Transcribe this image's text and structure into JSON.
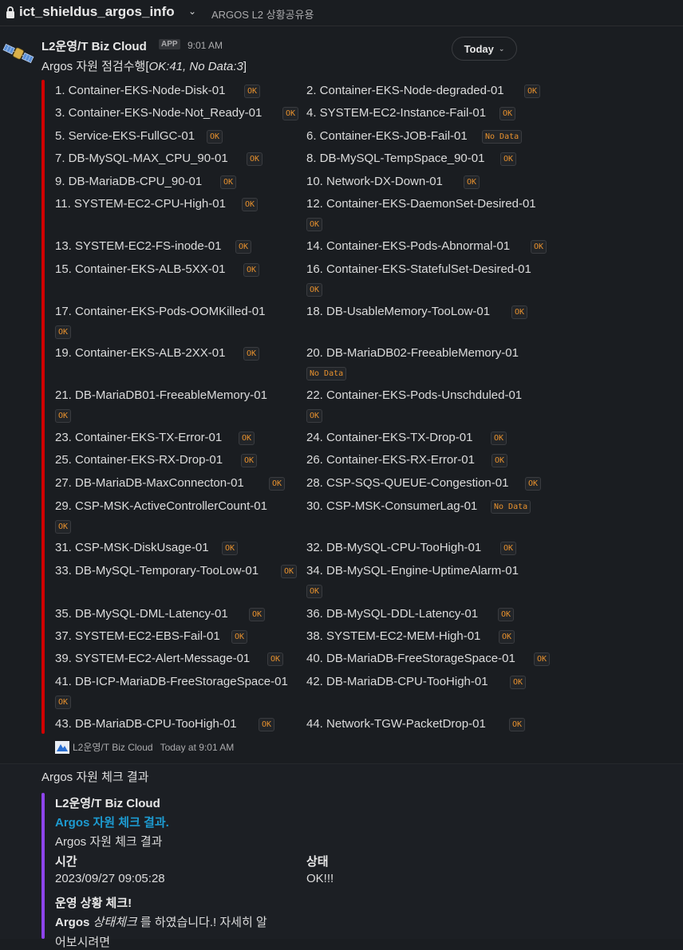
{
  "channel": {
    "name": "ict_shieldus_argos_info",
    "description": "ARGOS L2 상황공유용"
  },
  "message1": {
    "sender": "L2운영/T Biz Cloud",
    "app_badge": "APP",
    "time": "9:01 AM",
    "date_pill": "Today",
    "text_prefix": "Argos 자원 점검수행[",
    "text_italic": "OK:41, No Data:3",
    "text_suffix": "]",
    "items": [
      {
        "label": "1. Container-EKS-Node-Disk-01",
        "status": "OK"
      },
      {
        "label": "2. Container-EKS-Node-degraded-01",
        "status": "OK"
      },
      {
        "label": "3. Container-EKS-Node-Not_Ready-01",
        "status": "OK"
      },
      {
        "label": "4. SYSTEM-EC2-Instance-Fail-01",
        "status": "OK"
      },
      {
        "label": "5. Service-EKS-FullGC-01",
        "status": "OK"
      },
      {
        "label": "6. Container-EKS-JOB-Fail-01",
        "status": "No Data"
      },
      {
        "label": "7. DB-MySQL-MAX_CPU_90-01",
        "status": "OK"
      },
      {
        "label": "8. DB-MySQL-TempSpace_90-01",
        "status": "OK"
      },
      {
        "label": "9. DB-MariaDB-CPU_90-01",
        "status": "OK"
      },
      {
        "label": "10. Network-DX-Down-01",
        "status": "OK"
      },
      {
        "label": "11. SYSTEM-EC2-CPU-High-01",
        "status": "OK"
      },
      {
        "label": "12. Container-EKS-DaemonSet-Desired-01",
        "status": "OK"
      },
      {
        "label": "13. SYSTEM-EC2-FS-inode-01",
        "status": "OK"
      },
      {
        "label": "14. Container-EKS-Pods-Abnormal-01",
        "status": "OK"
      },
      {
        "label": "15. Container-EKS-ALB-5XX-01",
        "status": "OK"
      },
      {
        "label": "16. Container-EKS-StatefulSet-Desired-01",
        "status": "OK"
      },
      {
        "label": "17. Container-EKS-Pods-OOMKilled-01",
        "status": "OK"
      },
      {
        "label": "18. DB-UsableMemory-TooLow-01",
        "status": "OK"
      },
      {
        "label": "19. Container-EKS-ALB-2XX-01",
        "status": "OK"
      },
      {
        "label": "20. DB-MariaDB02-FreeableMemory-01",
        "status": "No Data"
      },
      {
        "label": "21. DB-MariaDB01-FreeableMemory-01",
        "status": "OK"
      },
      {
        "label": "22. Container-EKS-Pods-Unschduled-01",
        "status": "OK"
      },
      {
        "label": "23. Container-EKS-TX-Error-01",
        "status": "OK"
      },
      {
        "label": "24. Container-EKS-TX-Drop-01",
        "status": "OK"
      },
      {
        "label": "25. Container-EKS-RX-Drop-01",
        "status": "OK"
      },
      {
        "label": "26. Container-EKS-RX-Error-01",
        "status": "OK"
      },
      {
        "label": "27. DB-MariaDB-MaxConnecton-01",
        "status": "OK"
      },
      {
        "label": "28. CSP-SQS-QUEUE-Congestion-01",
        "status": "OK"
      },
      {
        "label": "29. CSP-MSK-ActiveControllerCount-01",
        "status": "OK"
      },
      {
        "label": "30. CSP-MSK-ConsumerLag-01",
        "status": "No Data"
      },
      {
        "label": "31. CSP-MSK-DiskUsage-01",
        "status": "OK"
      },
      {
        "label": "32. DB-MySQL-CPU-TooHigh-01",
        "status": "OK"
      },
      {
        "label": "33. DB-MySQL-Temporary-TooLow-01",
        "status": "OK"
      },
      {
        "label": "34. DB-MySQL-Engine-UptimeAlarm-01",
        "status": "OK"
      },
      {
        "label": "35. DB-MySQL-DML-Latency-01",
        "status": "OK"
      },
      {
        "label": "36. DB-MySQL-DDL-Latency-01",
        "status": "OK"
      },
      {
        "label": "37. SYSTEM-EC2-EBS-Fail-01",
        "status": "OK"
      },
      {
        "label": "38. SYSTEM-EC2-MEM-High-01",
        "status": "OK"
      },
      {
        "label": "39. SYSTEM-EC2-Alert-Message-01",
        "status": "OK"
      },
      {
        "label": "40. DB-MariaDB-FreeStorageSpace-01",
        "status": "OK"
      },
      {
        "label": "41. DB-ICP-MariaDB-FreeStorageSpace-01",
        "status": "OK"
      },
      {
        "label": "42. DB-MariaDB-CPU-TooHigh-01",
        "status": "OK"
      },
      {
        "label": "43. DB-MariaDB-CPU-TooHigh-01",
        "status": "OK"
      },
      {
        "label": "44. Network-TGW-PacketDrop-01",
        "status": "OK"
      }
    ],
    "footer_sender": "L2운영/T Biz Cloud",
    "footer_time": "Today at 9:01 AM",
    "accent_color": "#d00000"
  },
  "message2": {
    "text": "Argos 자원 체크 결과",
    "attachment": {
      "author": "L2운영/T Biz Cloud",
      "title_link": "Argos 자원 체크 결과.",
      "body": "Argos 자원 체크 결과",
      "field1_title": "시간",
      "field1_value": "2023/09/27 09:05:28",
      "field2_title": "상태",
      "field2_value": "OK!!!",
      "ops_title": "운영 상황 체크!",
      "line_bold": "Argos",
      "line_italic": "상태체크",
      "line_rest": "를 하였습니다.! 자세히 알",
      "cut_text": "어보시려면",
      "accent_color": "#8e44ec"
    }
  }
}
